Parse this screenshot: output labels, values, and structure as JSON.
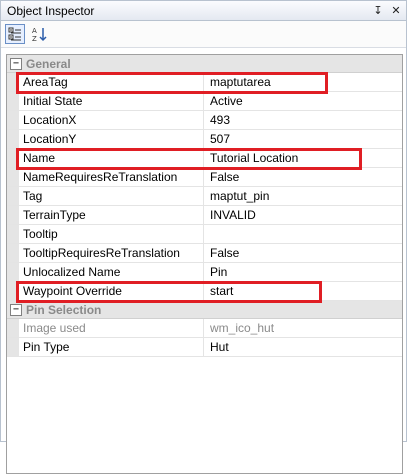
{
  "window": {
    "title": "Object Inspector",
    "pin_glyph": "↧",
    "close_glyph": "✕"
  },
  "toolbar": {
    "categorized_icon": "categorized-icon",
    "alphabetical_icon": "sort-alpha-icon"
  },
  "categories": [
    {
      "label": "General",
      "toggle": "−"
    },
    {
      "label": "Pin Selection",
      "toggle": "−"
    }
  ],
  "general": [
    {
      "name": "AreaTag",
      "value": "maptutarea"
    },
    {
      "name": "Initial State",
      "value": "Active"
    },
    {
      "name": "LocationX",
      "value": "493"
    },
    {
      "name": "LocationY",
      "value": "507"
    },
    {
      "name": "Name",
      "value": "Tutorial Location"
    },
    {
      "name": "NameRequiresReTranslation",
      "value": "False"
    },
    {
      "name": "Tag",
      "value": "maptut_pin"
    },
    {
      "name": "TerrainType",
      "value": "INVALID"
    },
    {
      "name": "Tooltip",
      "value": ""
    },
    {
      "name": "TooltipRequiresReTranslation",
      "value": "False"
    },
    {
      "name": "Unlocalized Name",
      "value": "Pin"
    },
    {
      "name": "Waypoint Override",
      "value": "start"
    }
  ],
  "pin_selection": [
    {
      "name": "Image used",
      "value": "wm_ico_hut"
    },
    {
      "name": "Pin Type",
      "value": "Hut"
    }
  ],
  "highlight_color": "#e01e24"
}
